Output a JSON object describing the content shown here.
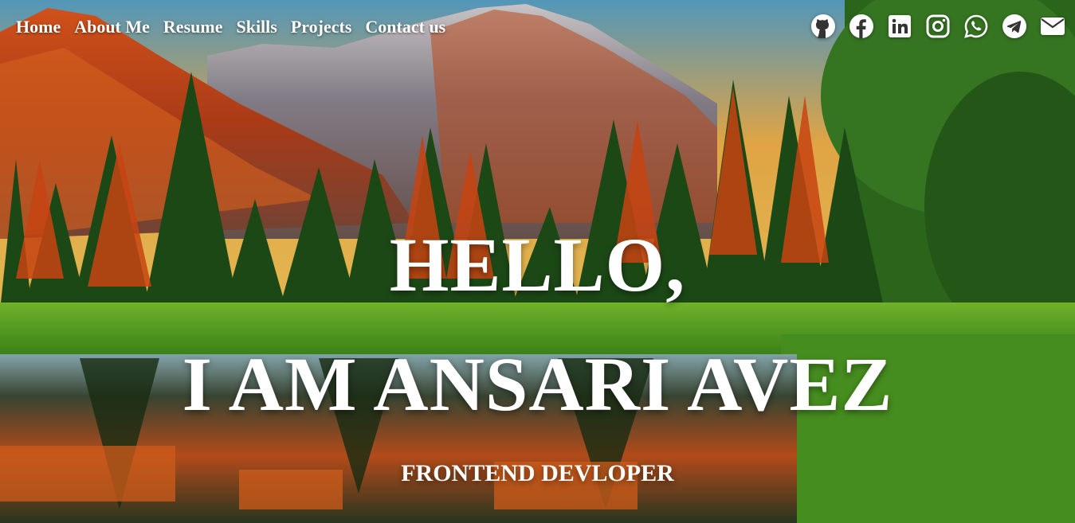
{
  "nav": {
    "items": [
      {
        "label": "Home"
      },
      {
        "label": "About Me"
      },
      {
        "label": "Resume"
      },
      {
        "label": "Skills"
      },
      {
        "label": "Projects"
      },
      {
        "label": "Contact us"
      }
    ]
  },
  "social": {
    "icons": [
      "github-icon",
      "facebook-icon",
      "linkedin-icon",
      "instagram-icon",
      "whatsapp-icon",
      "telegram-icon",
      "envelope-icon"
    ]
  },
  "hero": {
    "greeting": "HELLO,",
    "name": "I AM ANSARI AVEZ",
    "role": "FRONTEND DEVLOPER"
  },
  "colors": {
    "text": "#ffffff",
    "sky": "#f5a623",
    "forest": "#1f5a1a",
    "autumn": "#e2501a"
  }
}
